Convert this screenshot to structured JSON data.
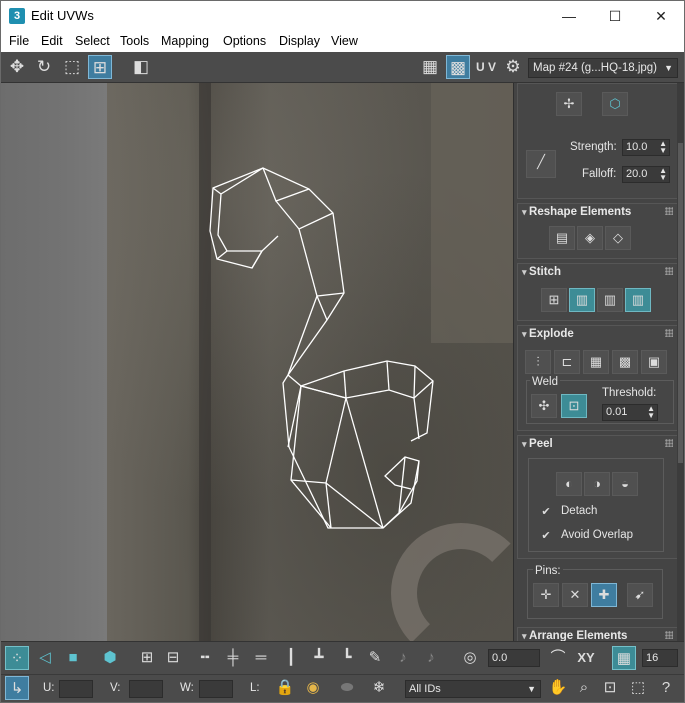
{
  "window": {
    "title": "Edit UVWs",
    "app_icon": "3",
    "minimize": "—",
    "maximize": "☐",
    "close": "✕"
  },
  "menu": [
    "File",
    "Edit",
    "Select",
    "Tools",
    "Mapping",
    "Options",
    "Display",
    "View"
  ],
  "toolbar": {
    "uv_label": "U V",
    "map_select": "Map #24 (g...HQ-18.jpg)"
  },
  "panel": {
    "strength_label": "Strength:",
    "strength_value": "10.0",
    "falloff_label": "Falloff:",
    "falloff_value": "20.0",
    "reshape_title": "Reshape Elements",
    "stitch_title": "Stitch",
    "explode_title": "Explode",
    "weld_label": "Weld",
    "threshold_label": "Threshold:",
    "threshold_value": "0.01",
    "peel_title": "Peel",
    "detach_label": "Detach",
    "avoid_overlap_label": "Avoid Overlap",
    "pins_label": "Pins:",
    "arrange_title": "Arrange Elements"
  },
  "bottom": {
    "angle_value": "0.0",
    "xy_label": "XY",
    "grid_value": "16",
    "u_label": "U:",
    "v_label": "V:",
    "w_label": "W:",
    "l_label": "L:",
    "ids_select": "All IDs"
  },
  "colors": {
    "accent": "#3d8c96",
    "active_blue": "#3f7da0",
    "wire": "#ffffff"
  }
}
